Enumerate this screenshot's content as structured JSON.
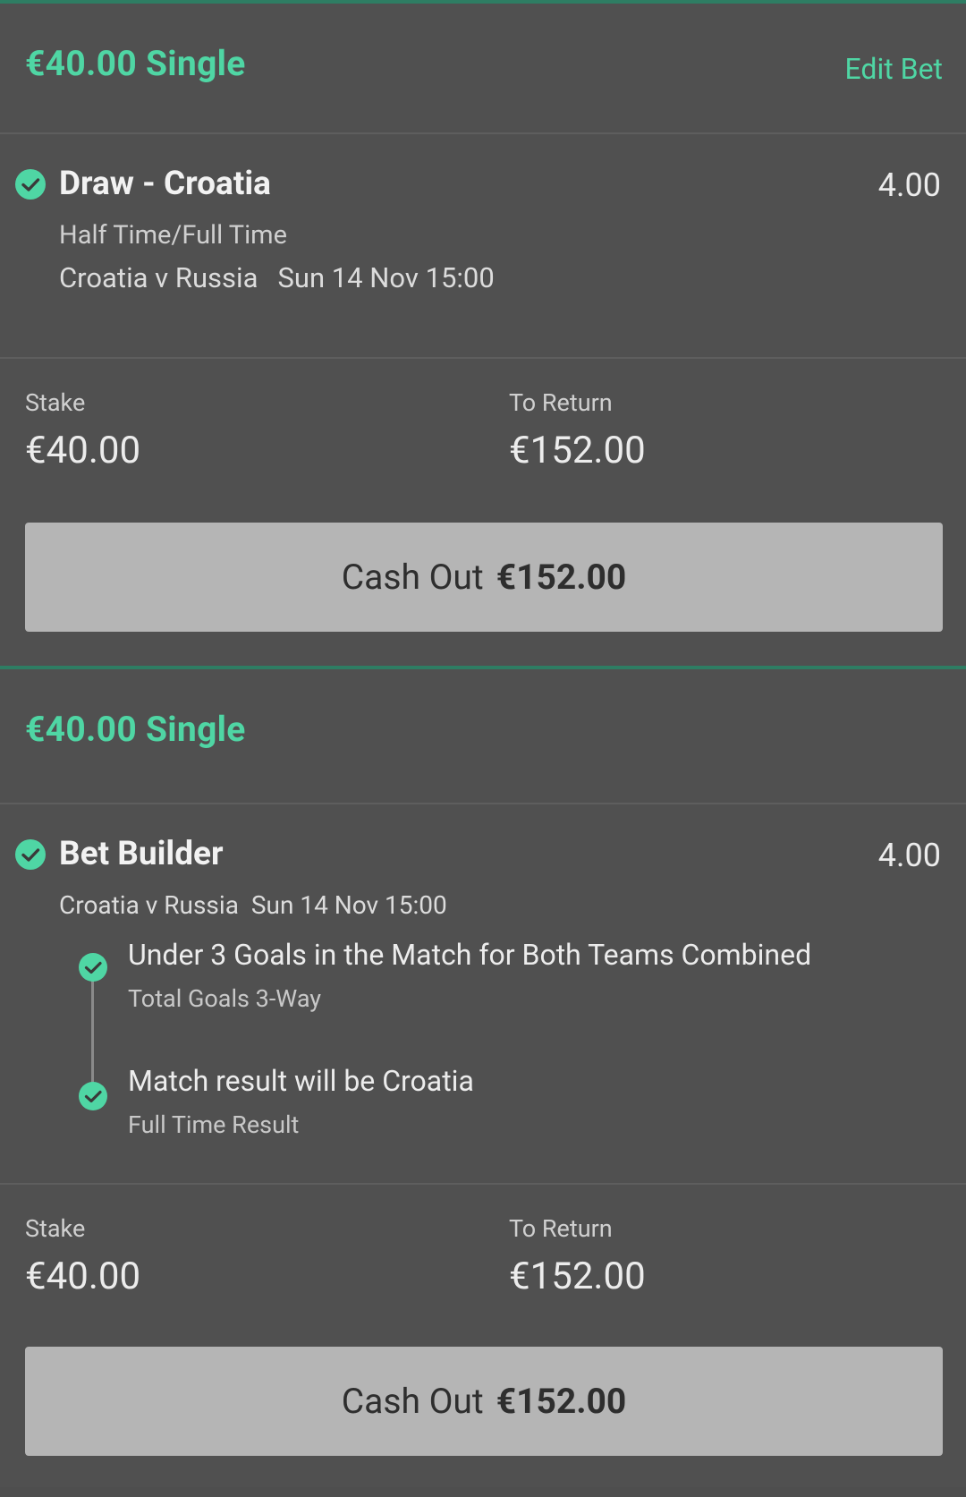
{
  "bets": [
    {
      "title": "€40.00 Single",
      "edit_label": "Edit Bet",
      "selection": "Draw - Croatia",
      "odds": "4.00",
      "market": "Half Time/Full Time",
      "event": "Croatia v Russia",
      "datetime": "Sun 14 Nov 15:00",
      "stake_label": "Stake",
      "stake_value": "€40.00",
      "return_label": "To Return",
      "return_value": "€152.00",
      "cashout_label": "Cash Out",
      "cashout_value": "€152.00"
    },
    {
      "title": "€40.00 Single",
      "selection": "Bet Builder",
      "odds": "4.00",
      "event": "Croatia v Russia",
      "datetime": "Sun 14 Nov 15:00",
      "legs": [
        {
          "name": "Under 3 Goals in the Match for Both Teams Combined",
          "market": "Total Goals 3-Way"
        },
        {
          "name": "Match result will be Croatia",
          "market": "Full Time Result"
        }
      ],
      "stake_label": "Stake",
      "stake_value": "€40.00",
      "return_label": "To Return",
      "return_value": "€152.00",
      "cashout_label": "Cash Out",
      "cashout_value": "€152.00"
    }
  ],
  "colors": {
    "accent": "#4fd6a4",
    "background": "#505050",
    "cashout_button": "#b5b5b5"
  },
  "icons": {
    "check": "check-circle-icon"
  }
}
